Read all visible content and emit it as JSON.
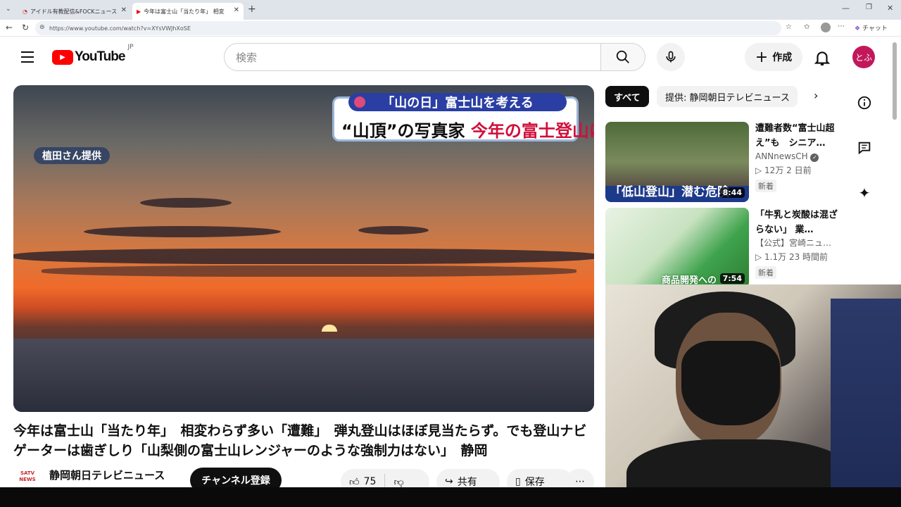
{
  "browser": {
    "tabs": [
      {
        "title": "アイドル有教配信&FOCKニュース"
      },
      {
        "title": "今年は富士山「当たり年」 相変"
      }
    ],
    "url": "https://www.youtube.com/watch?v=XYsVWJhXoSE",
    "copilot_label": "チャット"
  },
  "header": {
    "logo_text": "YouTube",
    "region": "JP",
    "search_placeholder": "検索",
    "create_label": "作成",
    "avatar_text": "とふ"
  },
  "video": {
    "credit": "植田さん提供",
    "caption_top": "「山の日」富士山を考える",
    "caption_left": "“山頂”の写真家",
    "caption_right": "今年の富士登山は",
    "title": "今年は富士山「当たり年」　相変わらず多い「遭難」　弾丸登山はほぼ見当たらず。でも登山ナビゲーターは歯ぎしり「山梨側の富士山レンジャーのような強制力はない」　静岡",
    "channel_name": "静岡朝日テレビニュース",
    "channel_logo": "SATV NEWS",
    "subscribe_label": "チャンネル登録",
    "like_count": "75",
    "share_label": "共有",
    "save_label": "保存"
  },
  "sidebar": {
    "chips": [
      "すべて",
      "提供: 静岡朝日テレビニュース"
    ],
    "recommendations": [
      {
        "title": "遭難者数“富士山超え”も　シニア…",
        "channel": "ANNnewsCH",
        "views_time": "▷ 12万  2 日前",
        "badge": "新着",
        "duration": "8:44",
        "thumb_caption": "「低山登山」潜む危険"
      },
      {
        "title": "「牛乳と炭酸は混ざらない」 業…",
        "channel": "【公式】宮崎ニュ…",
        "views_time": "▷ 1.1万  23 時間前",
        "badge": "新着",
        "duration": "7:54",
        "thumb_caption": "商品開発への"
      }
    ]
  }
}
